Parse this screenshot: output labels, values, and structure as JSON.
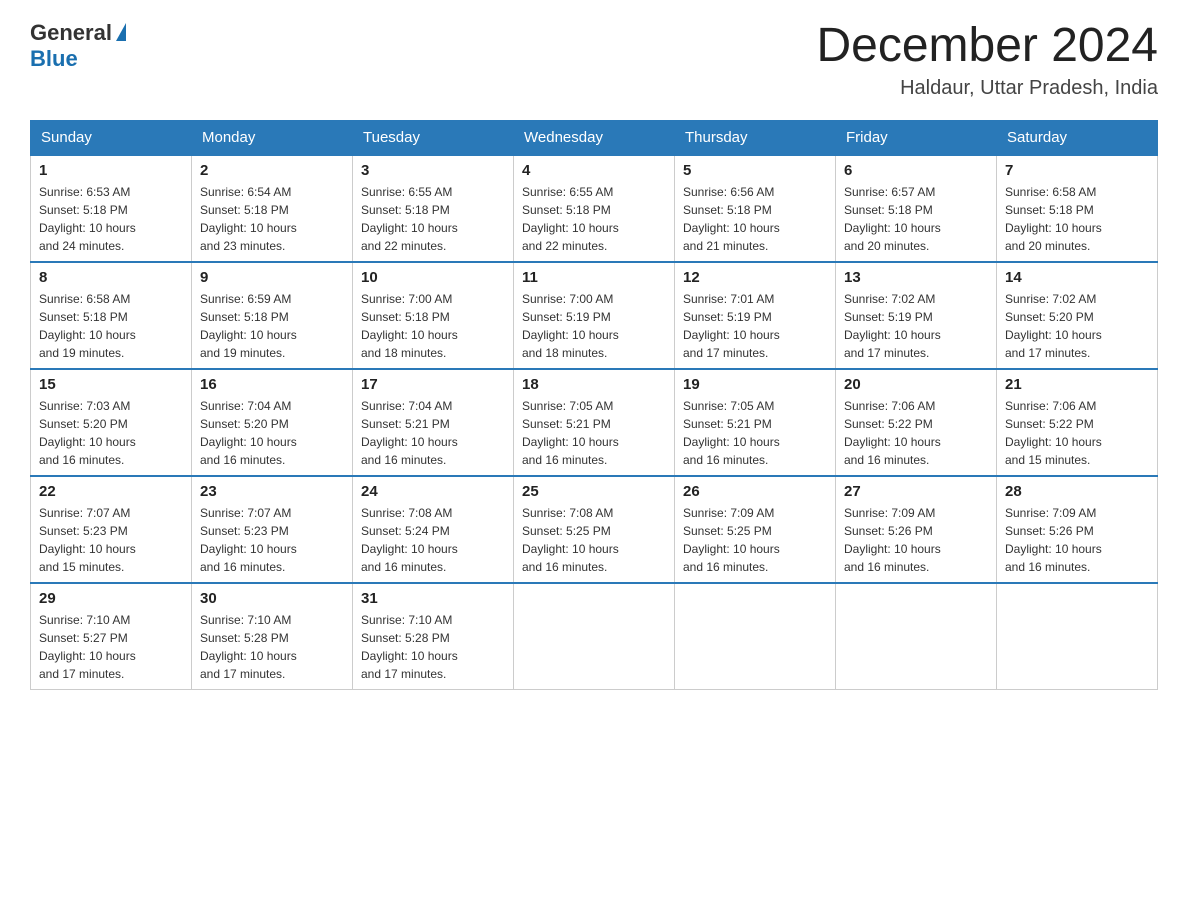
{
  "header": {
    "logo": {
      "general": "General",
      "blue": "Blue"
    },
    "title": "December 2024",
    "location": "Haldaur, Uttar Pradesh, India"
  },
  "days_of_week": [
    "Sunday",
    "Monday",
    "Tuesday",
    "Wednesday",
    "Thursday",
    "Friday",
    "Saturday"
  ],
  "weeks": [
    [
      {
        "day": "1",
        "sunrise": "6:53 AM",
        "sunset": "5:18 PM",
        "daylight": "10 hours and 24 minutes."
      },
      {
        "day": "2",
        "sunrise": "6:54 AM",
        "sunset": "5:18 PM",
        "daylight": "10 hours and 23 minutes."
      },
      {
        "day": "3",
        "sunrise": "6:55 AM",
        "sunset": "5:18 PM",
        "daylight": "10 hours and 22 minutes."
      },
      {
        "day": "4",
        "sunrise": "6:55 AM",
        "sunset": "5:18 PM",
        "daylight": "10 hours and 22 minutes."
      },
      {
        "day": "5",
        "sunrise": "6:56 AM",
        "sunset": "5:18 PM",
        "daylight": "10 hours and 21 minutes."
      },
      {
        "day": "6",
        "sunrise": "6:57 AM",
        "sunset": "5:18 PM",
        "daylight": "10 hours and 20 minutes."
      },
      {
        "day": "7",
        "sunrise": "6:58 AM",
        "sunset": "5:18 PM",
        "daylight": "10 hours and 20 minutes."
      }
    ],
    [
      {
        "day": "8",
        "sunrise": "6:58 AM",
        "sunset": "5:18 PM",
        "daylight": "10 hours and 19 minutes."
      },
      {
        "day": "9",
        "sunrise": "6:59 AM",
        "sunset": "5:18 PM",
        "daylight": "10 hours and 19 minutes."
      },
      {
        "day": "10",
        "sunrise": "7:00 AM",
        "sunset": "5:18 PM",
        "daylight": "10 hours and 18 minutes."
      },
      {
        "day": "11",
        "sunrise": "7:00 AM",
        "sunset": "5:19 PM",
        "daylight": "10 hours and 18 minutes."
      },
      {
        "day": "12",
        "sunrise": "7:01 AM",
        "sunset": "5:19 PM",
        "daylight": "10 hours and 17 minutes."
      },
      {
        "day": "13",
        "sunrise": "7:02 AM",
        "sunset": "5:19 PM",
        "daylight": "10 hours and 17 minutes."
      },
      {
        "day": "14",
        "sunrise": "7:02 AM",
        "sunset": "5:20 PM",
        "daylight": "10 hours and 17 minutes."
      }
    ],
    [
      {
        "day": "15",
        "sunrise": "7:03 AM",
        "sunset": "5:20 PM",
        "daylight": "10 hours and 16 minutes."
      },
      {
        "day": "16",
        "sunrise": "7:04 AM",
        "sunset": "5:20 PM",
        "daylight": "10 hours and 16 minutes."
      },
      {
        "day": "17",
        "sunrise": "7:04 AM",
        "sunset": "5:21 PM",
        "daylight": "10 hours and 16 minutes."
      },
      {
        "day": "18",
        "sunrise": "7:05 AM",
        "sunset": "5:21 PM",
        "daylight": "10 hours and 16 minutes."
      },
      {
        "day": "19",
        "sunrise": "7:05 AM",
        "sunset": "5:21 PM",
        "daylight": "10 hours and 16 minutes."
      },
      {
        "day": "20",
        "sunrise": "7:06 AM",
        "sunset": "5:22 PM",
        "daylight": "10 hours and 16 minutes."
      },
      {
        "day": "21",
        "sunrise": "7:06 AM",
        "sunset": "5:22 PM",
        "daylight": "10 hours and 15 minutes."
      }
    ],
    [
      {
        "day": "22",
        "sunrise": "7:07 AM",
        "sunset": "5:23 PM",
        "daylight": "10 hours and 15 minutes."
      },
      {
        "day": "23",
        "sunrise": "7:07 AM",
        "sunset": "5:23 PM",
        "daylight": "10 hours and 16 minutes."
      },
      {
        "day": "24",
        "sunrise": "7:08 AM",
        "sunset": "5:24 PM",
        "daylight": "10 hours and 16 minutes."
      },
      {
        "day": "25",
        "sunrise": "7:08 AM",
        "sunset": "5:25 PM",
        "daylight": "10 hours and 16 minutes."
      },
      {
        "day": "26",
        "sunrise": "7:09 AM",
        "sunset": "5:25 PM",
        "daylight": "10 hours and 16 minutes."
      },
      {
        "day": "27",
        "sunrise": "7:09 AM",
        "sunset": "5:26 PM",
        "daylight": "10 hours and 16 minutes."
      },
      {
        "day": "28",
        "sunrise": "7:09 AM",
        "sunset": "5:26 PM",
        "daylight": "10 hours and 16 minutes."
      }
    ],
    [
      {
        "day": "29",
        "sunrise": "7:10 AM",
        "sunset": "5:27 PM",
        "daylight": "10 hours and 17 minutes."
      },
      {
        "day": "30",
        "sunrise": "7:10 AM",
        "sunset": "5:28 PM",
        "daylight": "10 hours and 17 minutes."
      },
      {
        "day": "31",
        "sunrise": "7:10 AM",
        "sunset": "5:28 PM",
        "daylight": "10 hours and 17 minutes."
      },
      null,
      null,
      null,
      null
    ]
  ],
  "labels": {
    "sunrise": "Sunrise:",
    "sunset": "Sunset:",
    "daylight": "Daylight:"
  }
}
